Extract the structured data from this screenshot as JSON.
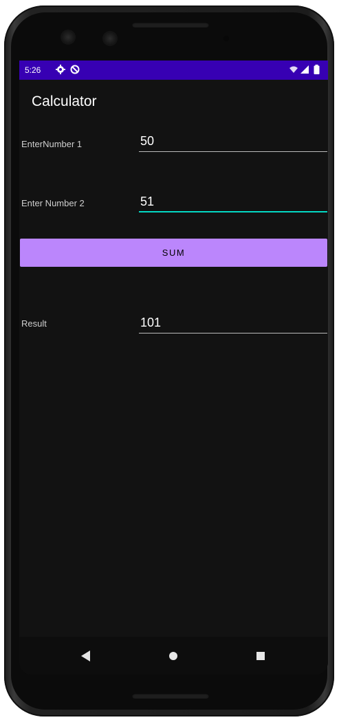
{
  "status_bar": {
    "time": "5:26",
    "icons": [
      "settings-icon",
      "data-saver-icon",
      "wifi-icon",
      "signal-icon",
      "battery-icon"
    ],
    "color": "#3700b3"
  },
  "app": {
    "title": "Calculator"
  },
  "form": {
    "number1_label": "EnterNumber 1",
    "number1_value": "50",
    "number2_label": "Enter Number 2",
    "number2_value": "51",
    "sum_button_label": "SUM",
    "result_label": "Result",
    "result_value": "101"
  },
  "colors": {
    "background": "#121212",
    "button": "#bb86fc",
    "focus_underline": "#03dac5"
  },
  "nav_bar": {
    "icons": [
      "back-icon",
      "home-icon",
      "recents-icon"
    ]
  }
}
